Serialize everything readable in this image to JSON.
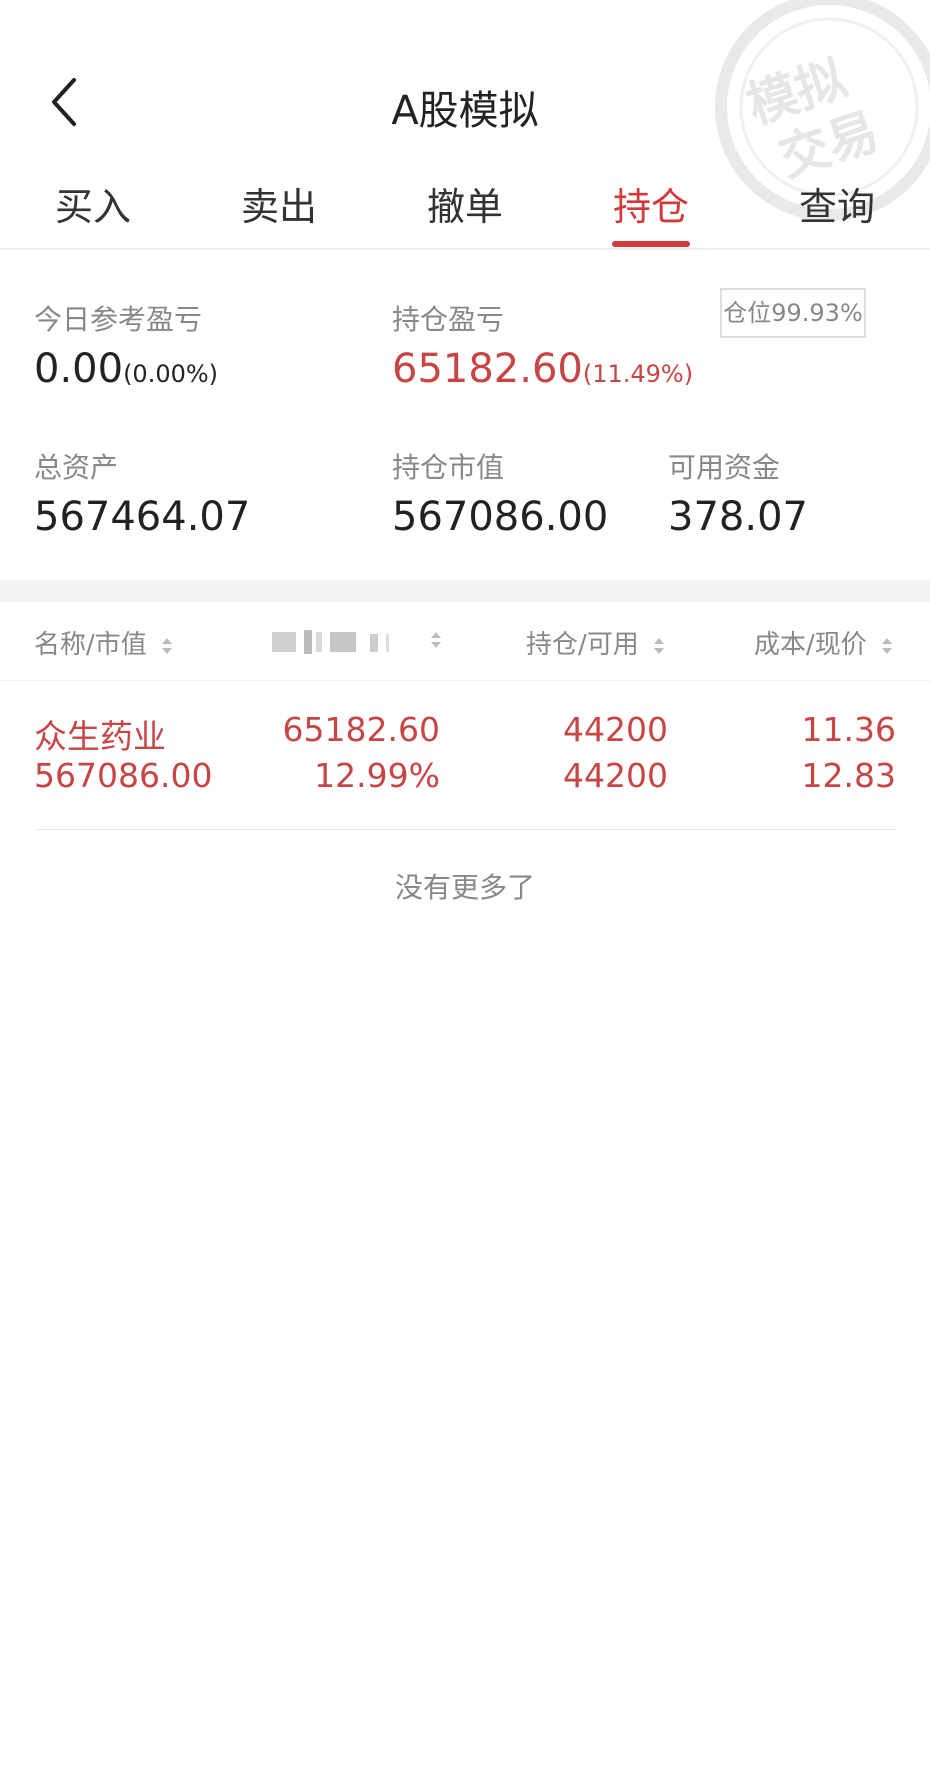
{
  "header": {
    "title": "A股模拟",
    "watermark_text": "模拟交易"
  },
  "tabs": [
    {
      "label": "买入"
    },
    {
      "label": "卖出"
    },
    {
      "label": "撤单"
    },
    {
      "label": "持仓",
      "active": true
    },
    {
      "label": "查询"
    }
  ],
  "summary": {
    "today_pl_label": "今日参考盈亏",
    "today_pl_value": "0.00",
    "today_pl_pct": "(0.00%)",
    "hold_pl_label": "持仓盈亏",
    "hold_pl_value": "65182.60",
    "hold_pl_pct": "(11.49%)",
    "position_badge": "仓位99.93%",
    "total_assets_label": "总资产",
    "total_assets_value": "567464.07",
    "market_value_label": "持仓市值",
    "market_value_value": "567086.00",
    "available_label": "可用资金",
    "available_value": "378.07"
  },
  "table": {
    "headers": [
      "名称/市值",
      "",
      "持仓/可用",
      "成本/现价"
    ],
    "rows": [
      {
        "name": "众生药业",
        "market_value": "567086.00",
        "pl": "65182.60",
        "pl_pct": "12.99%",
        "hold": "44200",
        "available": "44200",
        "cost": "11.36",
        "price": "12.83"
      }
    ],
    "footer": "没有更多了"
  },
  "colors": {
    "accent": "#d13a3a",
    "profit": "#c84545",
    "muted": "#888888"
  }
}
